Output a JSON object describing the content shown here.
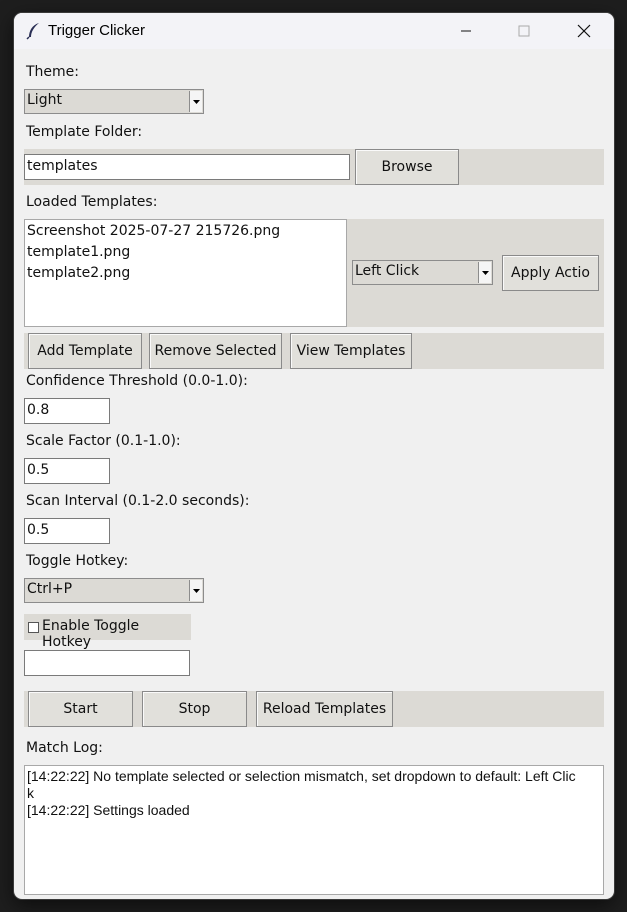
{
  "window": {
    "title": "Trigger Clicker"
  },
  "theme": {
    "label": "Theme:",
    "value": "Light"
  },
  "template_folder": {
    "label": "Template Folder:",
    "value": "templates",
    "browse_label": "Browse"
  },
  "loaded_templates": {
    "label": "Loaded Templates:",
    "items": [
      "Screenshot 2025-07-27 215726.png",
      "template1.png",
      "template2.png"
    ],
    "action_value": "Left Click",
    "apply_label": "Apply Actio"
  },
  "template_buttons": {
    "add": "Add Template",
    "remove": "Remove Selected",
    "view": "View Templates"
  },
  "confidence": {
    "label": "Confidence Threshold (0.0-1.0):",
    "value": "0.8"
  },
  "scale": {
    "label": "Scale Factor (0.1-1.0):",
    "value": "0.5"
  },
  "interval": {
    "label": "Scan Interval (0.1-2.0 seconds):",
    "value": "0.5"
  },
  "hotkey": {
    "label": "Toggle Hotkey:",
    "value": "Ctrl+P",
    "enable_label": "Enable Toggle Hotkey",
    "enabled": false,
    "extra_value": ""
  },
  "controls": {
    "start": "Start",
    "stop": "Stop",
    "reload": "Reload Templates"
  },
  "log": {
    "label": "Match Log:",
    "line1a": "[14:22:22] No template selected or selection mismatch, set dropdown to default: Left Clic",
    "line1b": "k",
    "line2": "[14:22:22] Settings loaded"
  }
}
